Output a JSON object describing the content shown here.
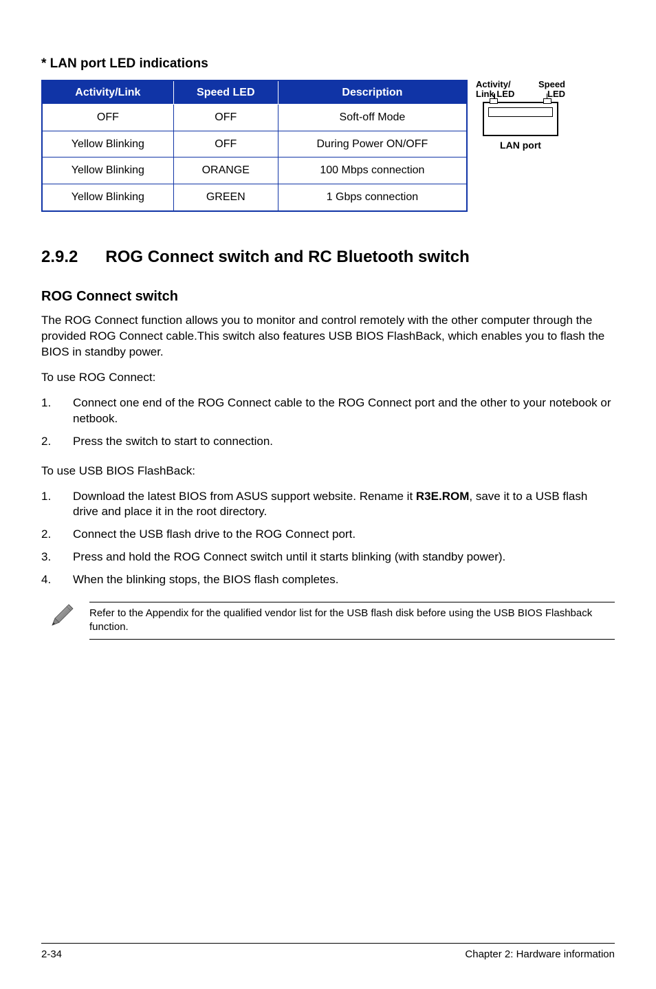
{
  "heading_lan": "* LAN port LED indications",
  "table": {
    "headers": [
      "Activity/Link",
      "Speed LED",
      "Description"
    ],
    "rows": [
      [
        "OFF",
        "OFF",
        "Soft-off Mode"
      ],
      [
        "Yellow Blinking",
        "OFF",
        "During Power ON/OFF"
      ],
      [
        "Yellow Blinking",
        "ORANGE",
        "100 Mbps connection"
      ],
      [
        "Yellow Blinking",
        "GREEN",
        "1 Gbps connection"
      ]
    ]
  },
  "diagram": {
    "label_left_1": "Activity/",
    "label_left_2": "Link LED",
    "label_right_1": "Speed",
    "label_right_2": "LED",
    "caption": "LAN port"
  },
  "section292": {
    "number": "2.9.2",
    "title": "ROG Connect switch and RC Bluetooth switch"
  },
  "rog": {
    "heading": "ROG Connect switch",
    "intro": "The ROG Connect function allows you to monitor and control remotely with the other computer through the provided ROG Connect cable.This switch also features USB BIOS FlashBack, which enables you to flash the BIOS in standby power.",
    "use_rog": "To use ROG Connect:",
    "steps_rog": [
      "Connect one end of the ROG Connect cable to the ROG Connect port and the other to your notebook or netbook.",
      "Press the switch to start to connection."
    ],
    "use_flash": "To use USB BIOS FlashBack:",
    "steps_flash": [
      {
        "pre": "Download the latest BIOS from ASUS support website. Rename it ",
        "bold": "R3E.ROM",
        "post": ", save it to a USB flash drive and place it in the root directory."
      },
      {
        "pre": "Connect the USB flash drive to the ROG Connect port.",
        "bold": "",
        "post": ""
      },
      {
        "pre": "Press and hold the ROG Connect switch until it starts blinking (with standby power).",
        "bold": "",
        "post": ""
      },
      {
        "pre": "When the blinking stops, the BIOS flash completes.",
        "bold": "",
        "post": ""
      }
    ]
  },
  "note": "Refer to the Appendix for the qualified vendor list for the USB flash disk before using the USB BIOS Flashback function.",
  "footer": {
    "left": "2-34",
    "right": "Chapter 2: Hardware information"
  }
}
